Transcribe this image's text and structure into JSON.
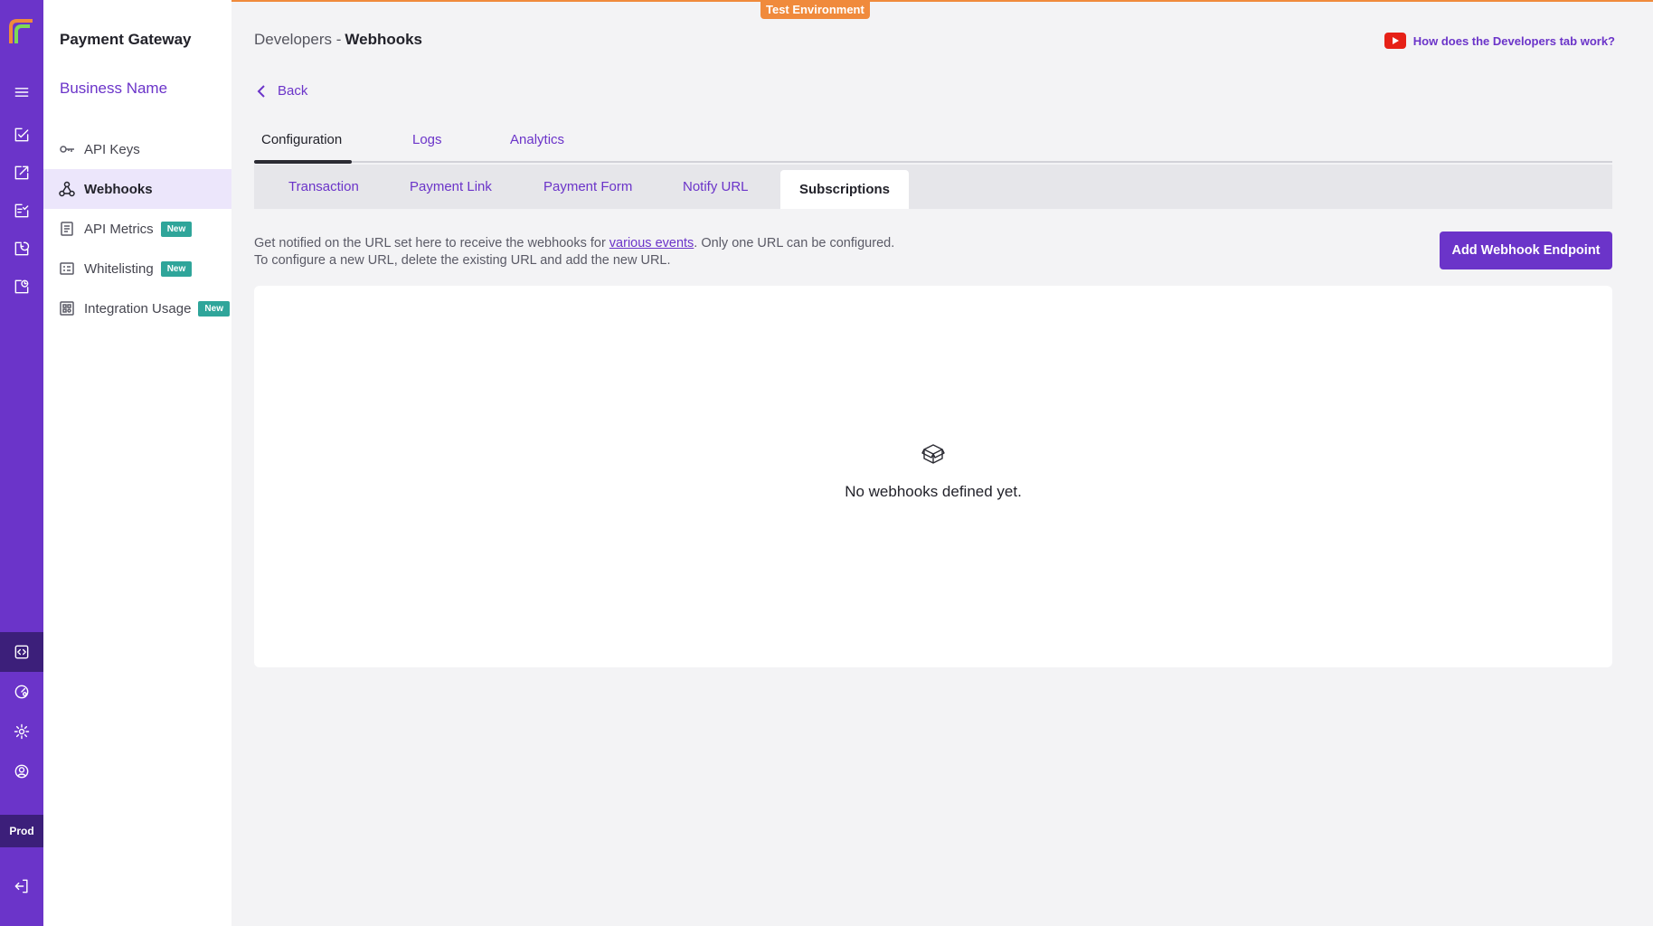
{
  "environment_label": "Test Environment",
  "rail": {
    "env_label": "Prod",
    "icons": [
      "logo-icon",
      "menu-icon",
      "edit-check-icon",
      "export-icon",
      "list-check-icon",
      "refresh-check-icon",
      "report-icon",
      "developers-icon",
      "dashboard-icon",
      "settings-icon",
      "profile-icon",
      "logout-icon"
    ]
  },
  "sidebar": {
    "product": "Payment Gateway",
    "business": "Business Name",
    "items": [
      {
        "label": "API Keys",
        "icon": "key-icon",
        "badge": ""
      },
      {
        "label": "Webhooks",
        "icon": "webhook-icon",
        "badge": ""
      },
      {
        "label": "API Metrics",
        "icon": "metrics-icon",
        "badge": "New"
      },
      {
        "label": "Whitelisting",
        "icon": "whitelist-icon",
        "badge": "New"
      },
      {
        "label": "Integration Usage",
        "icon": "integration-icon",
        "badge": "New"
      }
    ]
  },
  "header": {
    "crumb_parent": "Developers -",
    "crumb_current": "Webhooks",
    "help_link": "How does the Developers tab work?"
  },
  "back_label": "Back",
  "tabs": [
    "Configuration",
    "Logs",
    "Analytics"
  ],
  "subtabs": [
    "Transaction",
    "Payment Link",
    "Payment Form",
    "Notify URL",
    "Subscriptions"
  ],
  "description": {
    "line1_pre": "Get notified on the URL set here to receive the webhooks for ",
    "link": "various events",
    "line1_post": ". Only one URL can be configured.",
    "line2": "To configure a new URL, delete the existing URL and add the new URL."
  },
  "add_button": "Add Webhook Endpoint",
  "empty_state": "No webhooks defined yet.",
  "colors": {
    "brand": "#6b34c9",
    "env": "#f08a3c",
    "badge": "#2fa59a",
    "youtube": "#e62117"
  }
}
